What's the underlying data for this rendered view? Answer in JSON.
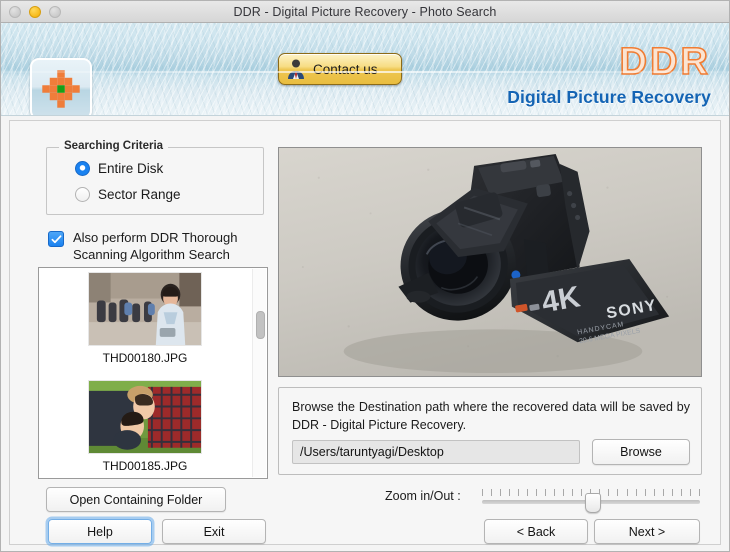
{
  "window": {
    "title": "DDR - Digital Picture Recovery - Photo Search",
    "traffic_lights": {
      "close": "close-button",
      "minimize": "minimize-button",
      "maximize": "maximize-button"
    }
  },
  "header": {
    "app_icon_name": "ddr-app-icon",
    "contact_button": "Contact us",
    "brand_title": "DDR",
    "brand_subtitle": "Digital Picture Recovery",
    "brand_color": "#f07d34",
    "brand_sub_color": "#1464b4"
  },
  "search_criteria": {
    "legend": "Searching Criteria",
    "options": [
      {
        "label": "Entire Disk",
        "selected": true
      },
      {
        "label": "Sector Range",
        "selected": false
      }
    ],
    "accent_color": "#1a82f0"
  },
  "thorough_scan": {
    "label": "Also perform DDR Thorough Scanning Algorithm Search",
    "checked": true
  },
  "thumbnails": [
    {
      "caption": "THD00180.JPG",
      "alt": "woman-with-phone-on-street"
    },
    {
      "caption": "THD00185.JPG",
      "alt": "couple-lying-on-grass"
    }
  ],
  "preview": {
    "alt": "sony-4k-handycam-camcorder",
    "label_4k": "4K",
    "label_brand": "SONY"
  },
  "destination": {
    "description": "Browse the Destination path where the recovered data will be saved by DDR - Digital Picture Recovery.",
    "path_value": "/Users/taruntyagi/Desktop",
    "path_placeholder": "/Users/taruntyagi/Desktop",
    "browse_label": "Browse"
  },
  "footer": {
    "open_folder_label": "Open Containing Folder",
    "help_label": "Help",
    "exit_label": "Exit",
    "back_label": "< Back",
    "next_label": "Next >",
    "zoom_label": "Zoom in/Out :",
    "zoom_value": 50
  }
}
